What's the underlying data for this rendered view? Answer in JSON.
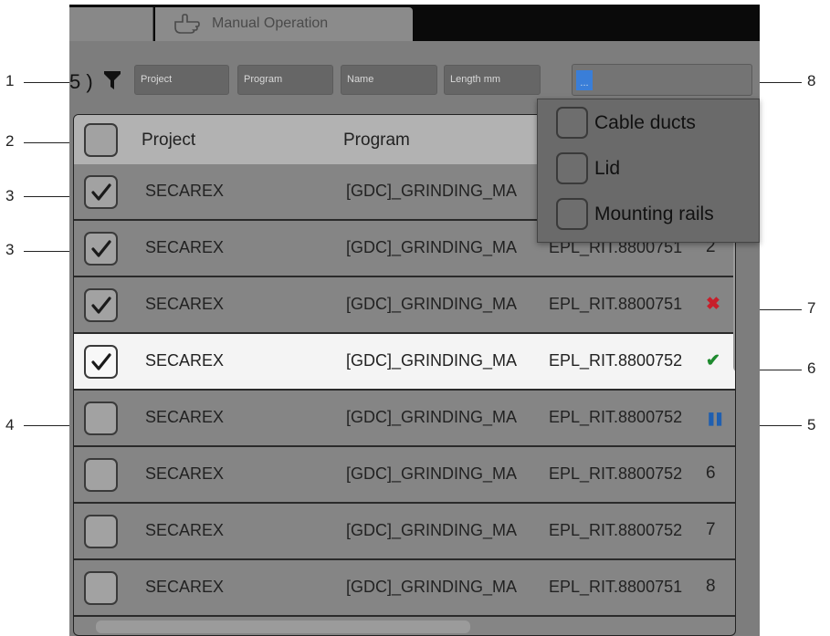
{
  "tabs": {
    "active_label": "Manual Operation"
  },
  "filter": {
    "count_label": "5 )",
    "project_placeholder": "Project",
    "program_placeholder": "Program",
    "name_placeholder": "Name",
    "length_placeholder": "Length mm",
    "category_value": "..."
  },
  "dropdown": {
    "options": [
      {
        "label": "Cable ducts",
        "checked": false
      },
      {
        "label": "Lid",
        "checked": false
      },
      {
        "label": "Mounting rails",
        "checked": false
      }
    ]
  },
  "table": {
    "headers": {
      "project": "Project",
      "program": "Program"
    },
    "rows": [
      {
        "checked": true,
        "project": "SECAREX",
        "program": "[GDC]_GRINDING_MA",
        "name": "",
        "status": ""
      },
      {
        "checked": true,
        "project": "SECAREX",
        "program": "[GDC]_GRINDING_MA",
        "name": "EPL_RIT.8800751",
        "status": "2"
      },
      {
        "checked": true,
        "project": "SECAREX",
        "program": "[GDC]_GRINDING_MA",
        "name": "EPL_RIT.8800751",
        "status": "✖"
      },
      {
        "checked": true,
        "project": "SECAREX",
        "program": "[GDC]_GRINDING_MA",
        "name": "EPL_RIT.8800752",
        "status": "✔",
        "selected": true
      },
      {
        "checked": false,
        "project": "SECAREX",
        "program": "[GDC]_GRINDING_MA",
        "name": "EPL_RIT.8800752",
        "status": "❚❚"
      },
      {
        "checked": false,
        "project": "SECAREX",
        "program": "[GDC]_GRINDING_MA",
        "name": "EPL_RIT.8800752",
        "status": "6"
      },
      {
        "checked": false,
        "project": "SECAREX",
        "program": "[GDC]_GRINDING_MA",
        "name": "EPL_RIT.8800752",
        "status": "7"
      },
      {
        "checked": false,
        "project": "SECAREX",
        "program": "[GDC]_GRINDING_MA",
        "name": "EPL_RIT.8800751",
        "status": "8"
      }
    ]
  },
  "callouts": {
    "c1": "1",
    "c2": "2",
    "c3a": "3",
    "c3b": "3",
    "c4": "4",
    "c5": "5",
    "c6": "6",
    "c7": "7",
    "c8": "8"
  },
  "colors": {
    "error": "#c81e2a",
    "ok": "#1e8a2e",
    "pause": "#1f5fb0",
    "selection": "#3a7ed8"
  },
  "icons": {
    "tab": "hand-pointer-icon",
    "filter": "funnel-icon",
    "check": "checkmark-icon"
  }
}
